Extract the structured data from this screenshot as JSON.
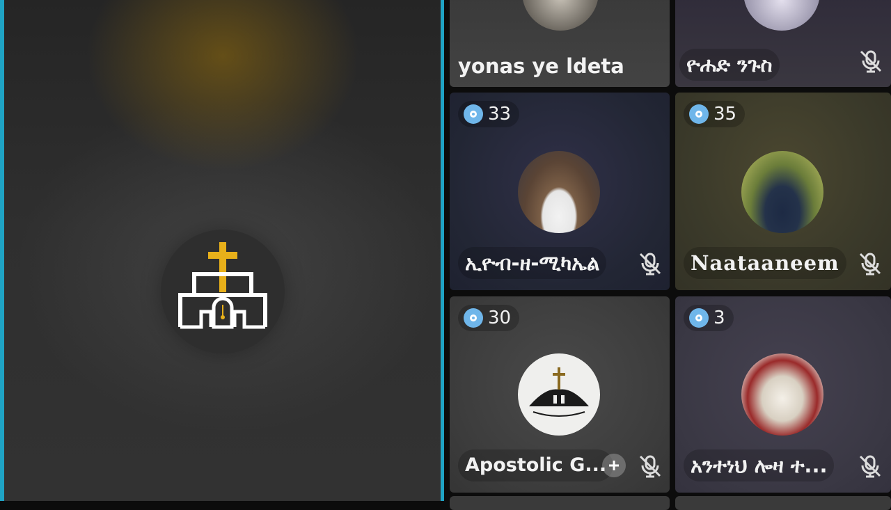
{
  "host": {
    "logo_icon": "church-cross-logo-icon"
  },
  "participants": [
    {
      "name": "yonas ye ldeta",
      "count": null,
      "muted": false
    },
    {
      "name": "ዮሐድ ንጉስ",
      "count": null,
      "muted": true
    },
    {
      "name": "ኢዮብ-ዘ-ሚካኤል",
      "count": "33",
      "muted": true
    },
    {
      "name": "Naataaneem",
      "count": "35",
      "muted": true
    },
    {
      "name": "Apostolic G...",
      "count": "30",
      "muted": true,
      "has_add": true
    },
    {
      "name": "አንተነህ ሎዛ ተ...",
      "count": "3",
      "muted": true
    }
  ],
  "colors": {
    "accent_border": "#1fa3c4",
    "badge": "#6fb6ea",
    "cross_gold": "#e8b01a"
  }
}
